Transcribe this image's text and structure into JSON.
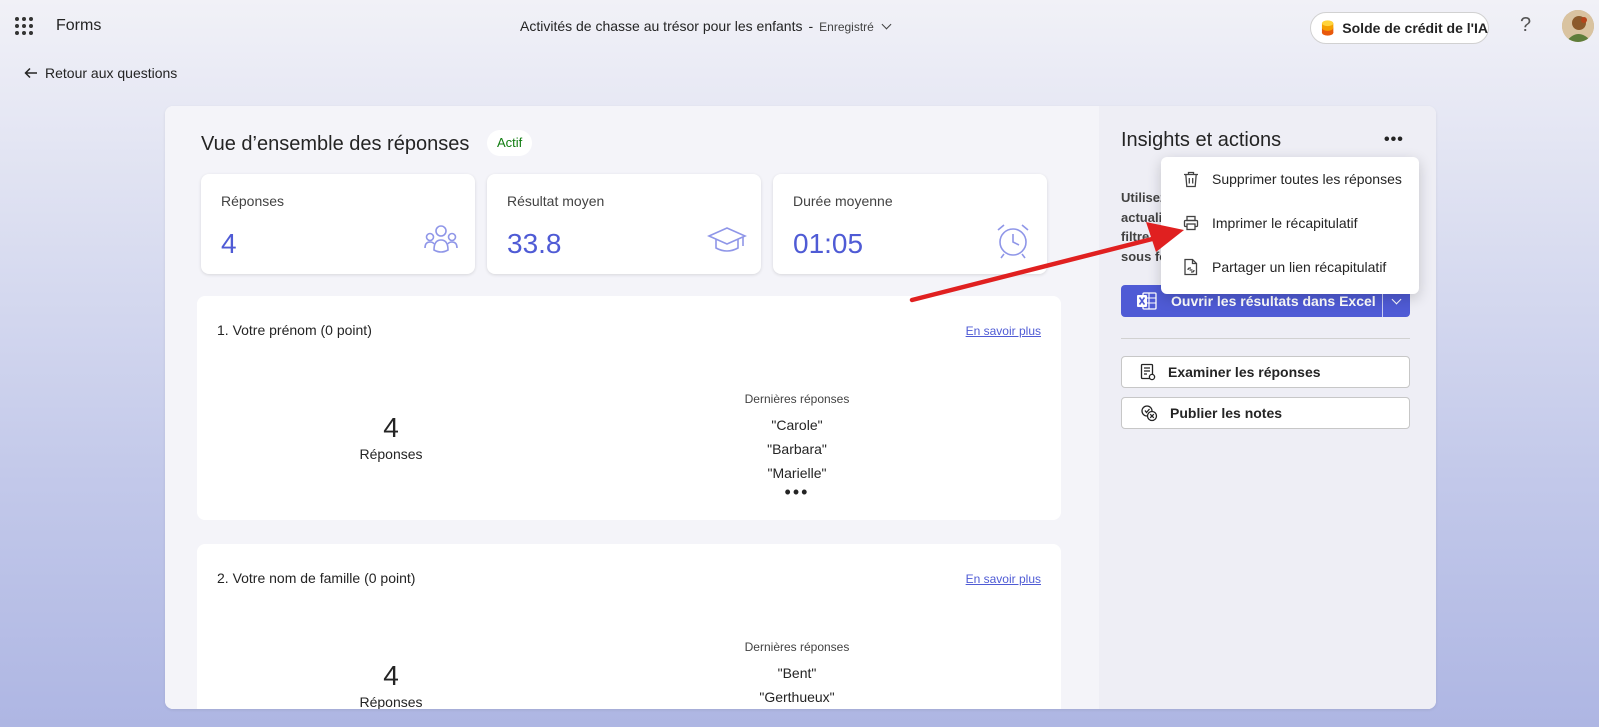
{
  "app": {
    "name": "Forms"
  },
  "document": {
    "title": "Activités de chasse au trésor pour les enfants",
    "separator": "-",
    "status": "Enregistré"
  },
  "header": {
    "credit_label": "Solde de crédit de l'IA",
    "help_label": "?"
  },
  "nav": {
    "back_label": "Retour aux questions"
  },
  "overview": {
    "title": "Vue d’ensemble des réponses",
    "status_badge": "Actif",
    "stats": [
      {
        "label": "Réponses",
        "value": "4",
        "icon": "people-icon"
      },
      {
        "label": "Résultat moyen",
        "value": "33.8",
        "icon": "graduation-cap-icon"
      },
      {
        "label": "Durée moyenne",
        "value": "01:05",
        "icon": "alarm-clock-icon"
      }
    ]
  },
  "questions": [
    {
      "title": "1. Votre prénom (0 point)",
      "link": "En savoir plus",
      "count": "4",
      "count_label": "Réponses",
      "latest_header": "Dernières réponses",
      "latest": [
        "\"Carole\"",
        "\"Barbara\"",
        "\"Marielle\""
      ],
      "more": "•••"
    },
    {
      "title": "2. Votre nom de famille (0 point)",
      "link": "En savoir plus",
      "count": "4",
      "count_label": "Réponses",
      "latest_header": "Dernières réponses",
      "latest": [
        "\"Bent\"",
        "\"Gerthueux\""
      ]
    }
  ],
  "insights": {
    "title": "Insights et actions",
    "more": "•••",
    "info_lines": [
      "Utilisez",
      "actuali",
      "filtre",
      "sous fo"
    ],
    "excel_button": "Ouvrir les résultats dans Excel",
    "review_button": "Examiner les réponses",
    "publish_button": "Publier les notes"
  },
  "menu": {
    "items": [
      {
        "label": "Supprimer toutes les réponses",
        "icon": "trash-icon"
      },
      {
        "label": "Imprimer le récapitulatif",
        "icon": "printer-icon"
      },
      {
        "label": "Partager un lien récapitulatif",
        "icon": "share-link-icon"
      }
    ]
  },
  "colors": {
    "accent": "#4f5bd5",
    "active": "#107c10",
    "annotation_arrow": "#e02020"
  }
}
